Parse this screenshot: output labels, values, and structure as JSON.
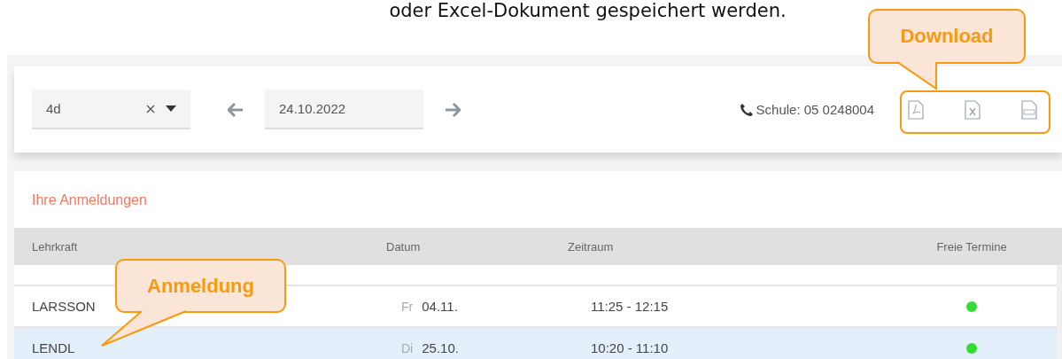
{
  "document_text": "oder Excel-Dokument gespeichert werden.",
  "toolbar": {
    "class_select": {
      "value": "4d"
    },
    "date_field": {
      "value": "24.10.2022"
    },
    "phone": {
      "label": "Schule: 05 0248004"
    },
    "downloads": [
      {
        "kind": "pdf"
      },
      {
        "kind": "xlsx"
      },
      {
        "kind": "csv"
      }
    ]
  },
  "registrations": {
    "title": "Ihre Anmeldungen",
    "columns": [
      "Lehrkraft",
      "Datum",
      "Zeitraum",
      "Freie Termine"
    ],
    "rows": [
      {
        "teacher": "LARSSON",
        "day": "Fr",
        "date": "04.11.",
        "time": "11:25 - 12:15",
        "selected": false,
        "color": "#33dd33"
      },
      {
        "teacher": "LENDL",
        "day": "Di",
        "date": "25.10.",
        "time": "10:20 - 11:10",
        "selected": true,
        "color": "#33dd33"
      }
    ]
  },
  "callouts": [
    {
      "kind": "download",
      "text": "Download"
    },
    {
      "kind": "registration",
      "text": "Anmeldung"
    }
  ]
}
